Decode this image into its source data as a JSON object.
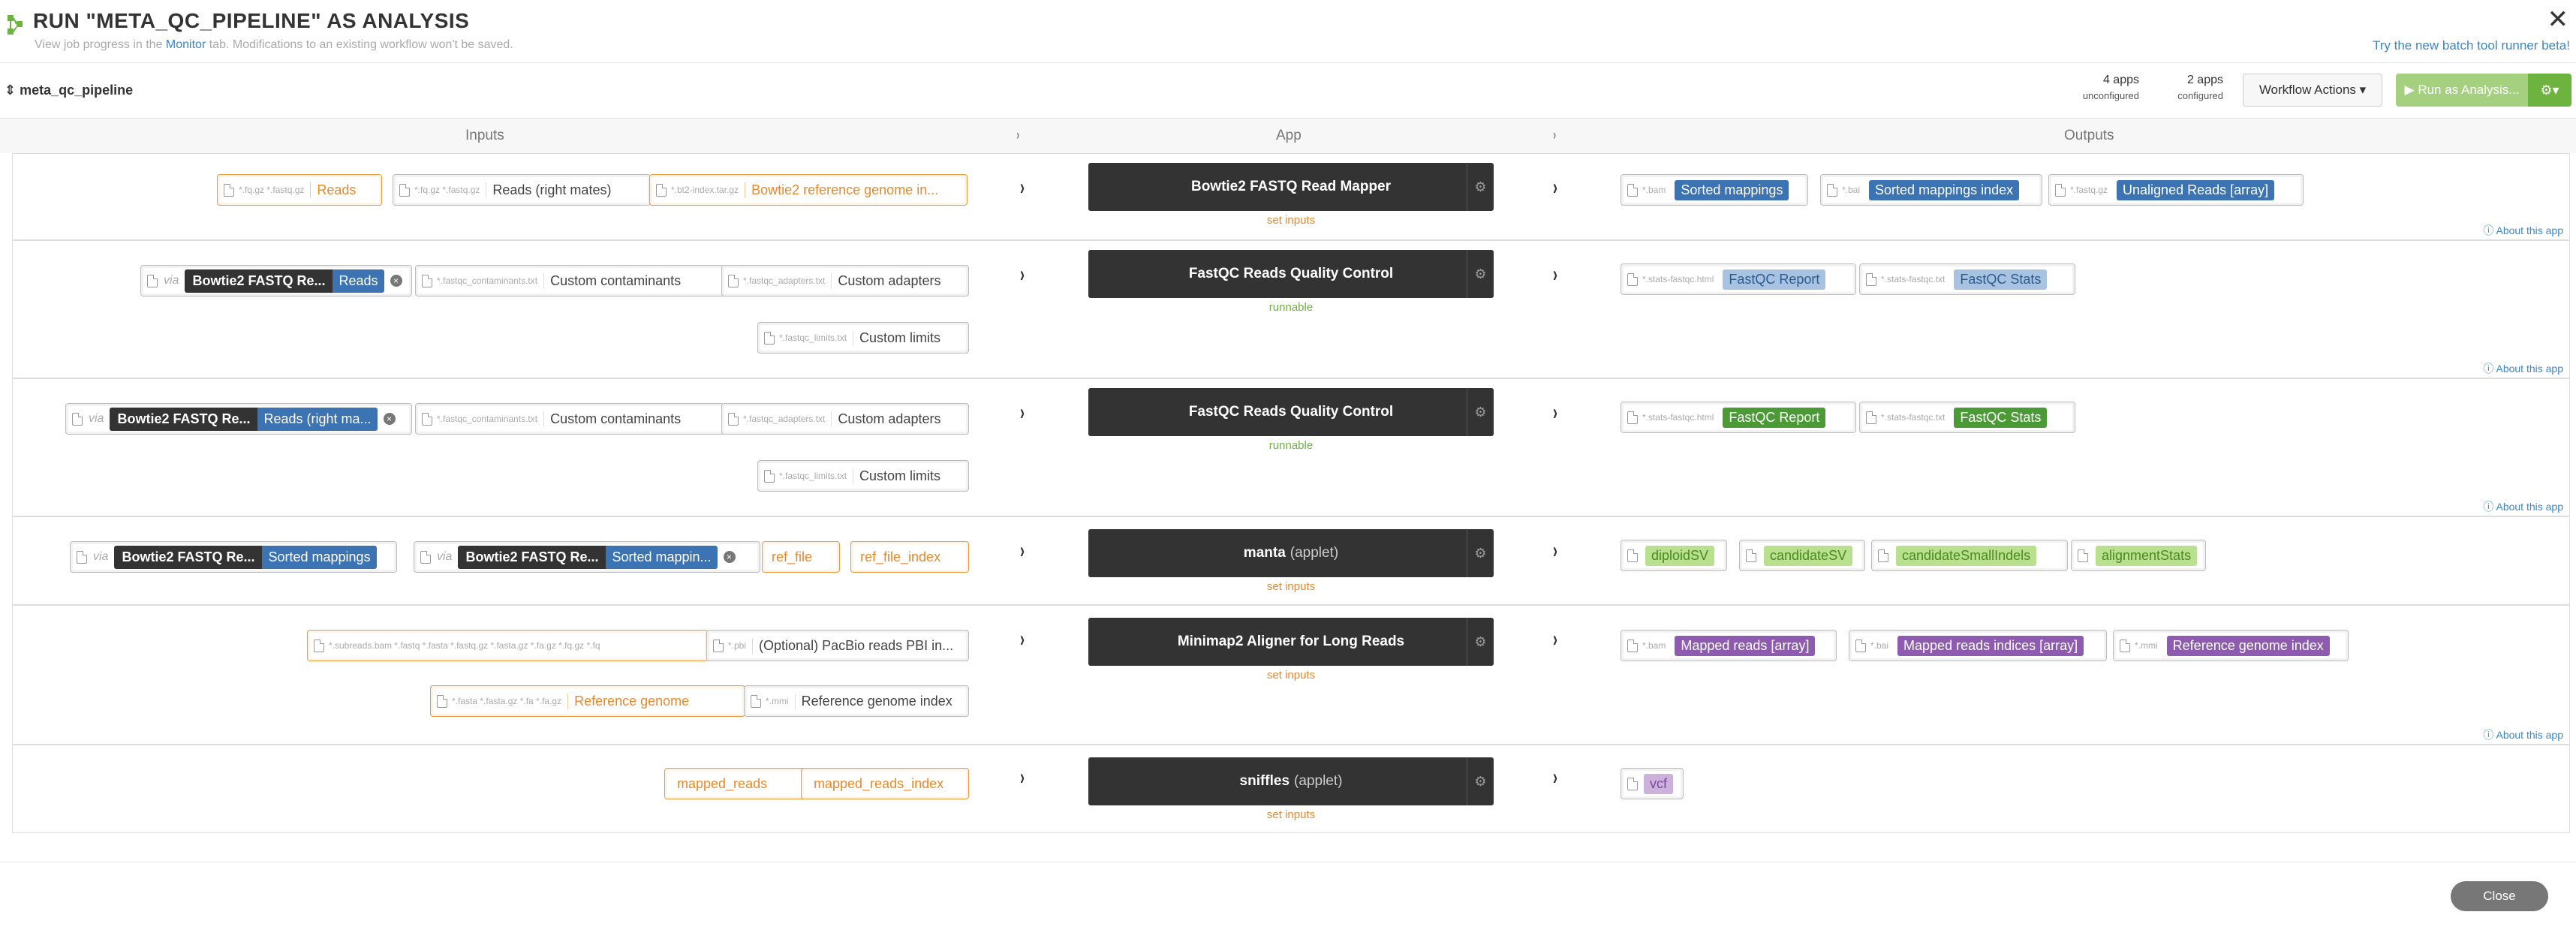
{
  "header": {
    "title": "RUN \"META_QC_PIPELINE\" AS ANALYSIS",
    "subtitle_pre": "View job progress in the",
    "subtitle_link": "Monitor",
    "subtitle_post": "tab. Modifications to an existing workflow won't be saved.",
    "close": "✕",
    "beta_link": "Try the new batch tool runner beta!"
  },
  "toolbar": {
    "workflow_name": "meta_qc_pipeline",
    "unconfigured_count": "4 apps",
    "unconfigured_label": "unconfigured",
    "configured_count": "2 apps",
    "configured_label": "configured",
    "workflow_actions": "Workflow Actions ▾",
    "run_button": "▶ Run as Analysis...",
    "gear_button": "⚙▾"
  },
  "columns": {
    "inputs": "Inputs",
    "app": "App",
    "outputs": "Outputs"
  },
  "stages": [
    {
      "app": "Bowtie2 FASTQ Read Mapper",
      "applet": "",
      "status": "set inputs",
      "about": "About this app",
      "inputs": [
        {
          "ext": "*.fq.gz  *.fastq.gz",
          "label": "Reads"
        },
        {
          "ext": "*.fq.gz  *.fastq.gz",
          "label": "Reads (right mates)"
        },
        {
          "ext": "*.bt2-index.tar.gz",
          "label": "Bowtie2 reference genome in..."
        }
      ],
      "outputs": [
        {
          "ext": "*.bam",
          "label": "Sorted mappings"
        },
        {
          "ext": "*.bai",
          "label": "Sorted mappings index"
        },
        {
          "ext": "*.fastq.gz",
          "label": "Unaligned Reads [array]"
        }
      ]
    },
    {
      "app": "FastQC Reads Quality Control",
      "applet": "",
      "status": "runnable",
      "about": "About this app",
      "inputs": [
        {
          "via": "via",
          "src": "Bowtie2 FASTQ Re...",
          "label": "Reads",
          "x": "×"
        },
        {
          "ext": "*.fastqc_contaminants.txt",
          "label": "Custom contaminants"
        },
        {
          "ext": "*.fastqc_adapters.txt",
          "label": "Custom adapters"
        },
        {
          "ext": "*.fastqc_limits.txt",
          "label": "Custom limits"
        }
      ],
      "outputs": [
        {
          "ext": "*.stats-fastqc.html",
          "label": "FastQC Report"
        },
        {
          "ext": "*.stats-fastqc.txt",
          "label": "FastQC Stats"
        }
      ]
    },
    {
      "app": "FastQC Reads Quality Control",
      "applet": "",
      "status": "runnable",
      "about": "About this app",
      "inputs": [
        {
          "via": "via",
          "src": "Bowtie2 FASTQ Re...",
          "label": "Reads (right ma...",
          "x": "×"
        },
        {
          "ext": "*.fastqc_contaminants.txt",
          "label": "Custom contaminants"
        },
        {
          "ext": "*.fastqc_adapters.txt",
          "label": "Custom adapters"
        },
        {
          "ext": "*.fastqc_limits.txt",
          "label": "Custom limits"
        }
      ],
      "outputs": [
        {
          "ext": "*.stats-fastqc.html",
          "label": "FastQC Report"
        },
        {
          "ext": "*.stats-fastqc.txt",
          "label": "FastQC Stats"
        }
      ]
    },
    {
      "app": "manta",
      "applet": "(applet)",
      "status": "set inputs",
      "about": "",
      "inputs": [
        {
          "via": "via",
          "src": "Bowtie2 FASTQ Re...",
          "label": "Sorted mappings",
          "x": ""
        },
        {
          "via": "via",
          "src": "Bowtie2 FASTQ Re...",
          "label": "Sorted mappin...",
          "x": "×"
        },
        {
          "label": "ref_file"
        },
        {
          "label": "ref_file_index"
        }
      ],
      "outputs": [
        {
          "label": "diploidSV"
        },
        {
          "label": "candidateSV"
        },
        {
          "label": "candidateSmallIndels"
        },
        {
          "label": "alignmentStats"
        }
      ]
    },
    {
      "app": "Minimap2 Aligner for Long Reads",
      "applet": "",
      "status": "set inputs",
      "about": "About this app",
      "inputs": [
        {
          "ext": "*.subreads.bam  *.fastq  *.fasta  *.fastq.gz  *.fasta.gz  *.fa.gz  *.fq.gz  *.fq",
          "label": ""
        },
        {
          "ext": "*.pbi",
          "label": "(Optional) PacBio reads PBI in..."
        },
        {
          "ext": "*.fasta  *.fasta.gz  *.fa  *.fa.gz",
          "label": "Reference genome"
        },
        {
          "ext": "*.mmi",
          "label": "Reference genome index"
        }
      ],
      "outputs": [
        {
          "ext": "*.bam",
          "label": "Mapped reads [array]"
        },
        {
          "ext": "*.bai",
          "label": "Mapped reads indices [array]"
        },
        {
          "ext": "*.mmi",
          "label": "Reference genome index"
        }
      ]
    },
    {
      "app": "sniffles",
      "applet": "(applet)",
      "status": "set inputs",
      "about": "",
      "inputs": [
        {
          "label": "mapped_reads"
        },
        {
          "label": "mapped_reads_index"
        }
      ],
      "outputs": [
        {
          "label": "vcf"
        }
      ]
    }
  ],
  "icons": {
    "arrow": "›",
    "gear": "⚙"
  },
  "footer": {
    "close_button": "Close"
  }
}
